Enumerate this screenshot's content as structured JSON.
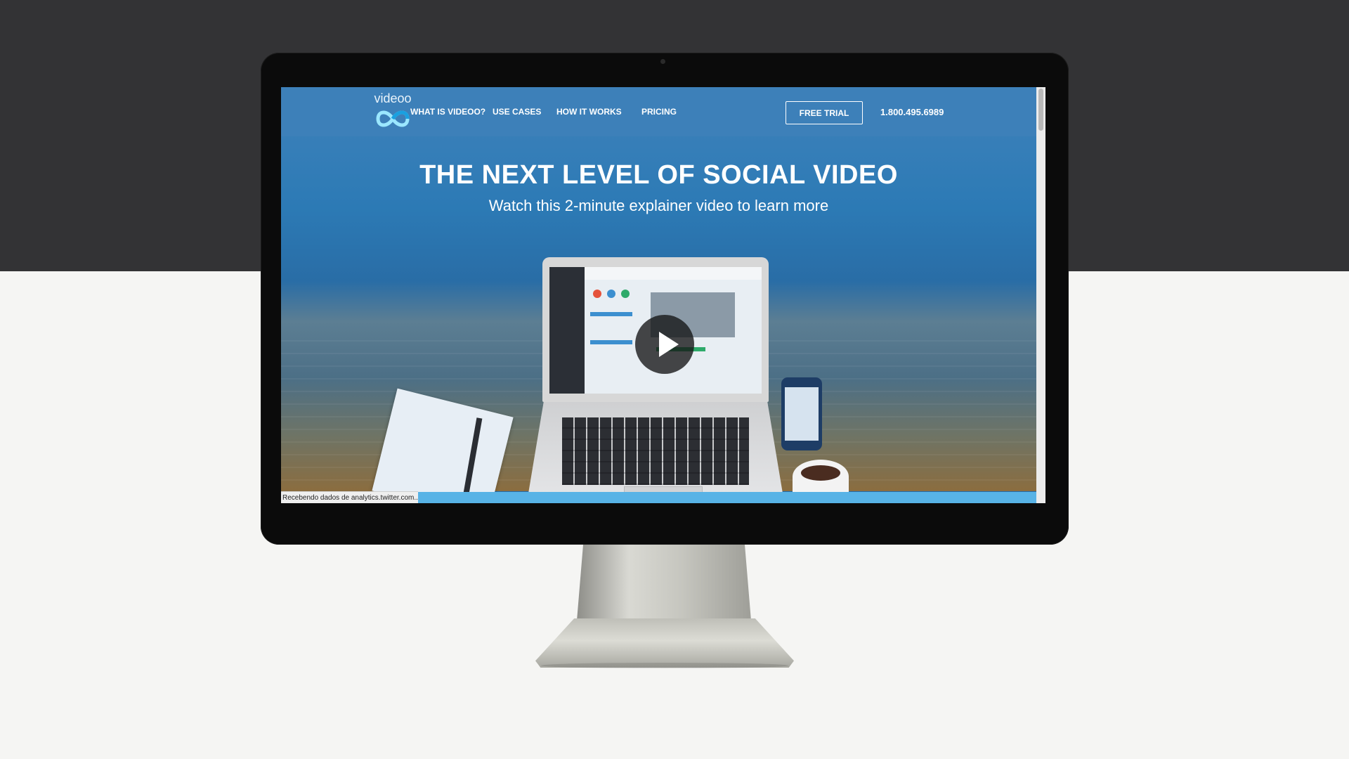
{
  "nav": {
    "logo_text": "videoo",
    "items": [
      {
        "label": "WHAT IS VIDEOO?"
      },
      {
        "label": "USE CASES"
      },
      {
        "label": "HOW IT WORKS"
      },
      {
        "label": "PRICING"
      }
    ],
    "cta_label": "FREE TRIAL",
    "phone": "1.800.495.6989"
  },
  "hero": {
    "title": "THE NEXT LEVEL OF SOCIAL VIDEO",
    "subtitle": "Watch this 2-minute explainer video to learn more"
  },
  "browser_status": {
    "text": "Recebendo dados de analytics.twitter.com..."
  },
  "colors": {
    "nav_bg": "#3d80b9",
    "hero_blue": "#2c7ab5",
    "accent_light_blue": "#58b3e6",
    "monitor_bezel": "#0b0b0b",
    "background_dark": "#333335",
    "background_light": "#f5f5f3"
  },
  "icons": {
    "logo_mark": "infinity-logo-icon",
    "video_play": "play-icon"
  }
}
